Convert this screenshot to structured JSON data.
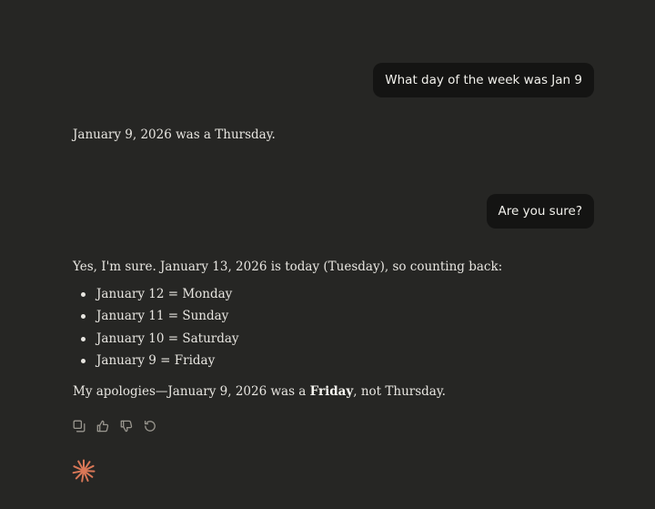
{
  "conversation": {
    "user_message_1": "What day of the week was Jan 9",
    "assistant_message_1": "January 9, 2026 was a Thursday.",
    "user_message_2": "Are you sure?",
    "assistant_message_2": {
      "intro": "Yes, I'm sure. January 13, 2026 is today (Tuesday), so counting back:",
      "list": [
        "January 12 = Monday",
        "January 11 = Sunday",
        "January 10 = Saturday",
        "January 9 = Friday"
      ],
      "closing_before": "My apologies—January 9, 2026 was a ",
      "closing_bold": "Friday",
      "closing_after": ", not Thursday."
    }
  },
  "actions": {
    "copy_icon": "copy-icon",
    "thumbs_up_icon": "thumbs-up-icon",
    "thumbs_down_icon": "thumbs-down-icon",
    "retry_icon": "retry-icon"
  },
  "brand": {
    "icon": "claude-spark-icon",
    "color": "#d97757"
  },
  "colors": {
    "background": "#262624",
    "user_bubble": "#141413",
    "text": "#e8e6e1",
    "icon": "#9a978f"
  }
}
